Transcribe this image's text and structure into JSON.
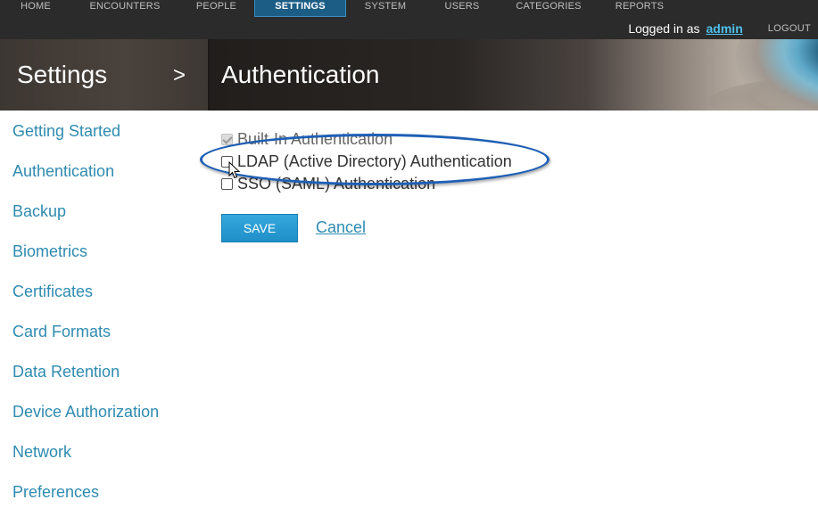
{
  "nav": {
    "items": [
      {
        "label": "HOME"
      },
      {
        "label": "ENCOUNTERS"
      },
      {
        "label": "PEOPLE"
      },
      {
        "label": "SETTINGS",
        "active": true
      },
      {
        "label": "SYSTEM"
      },
      {
        "label": "USERS"
      },
      {
        "label": "CATEGORIES"
      },
      {
        "label": "REPORTS"
      }
    ],
    "login_prefix": "Logged in as",
    "username": "admin",
    "logout_label": "LOGOUT"
  },
  "header": {
    "section_title": "Settings",
    "arrow": ">",
    "page_title": "Authentication"
  },
  "sidebar": {
    "items": [
      {
        "label": "Getting Started"
      },
      {
        "label": "Authentication"
      },
      {
        "label": "Backup"
      },
      {
        "label": "Biometrics"
      },
      {
        "label": "Certificates"
      },
      {
        "label": "Card Formats"
      },
      {
        "label": "Data Retention"
      },
      {
        "label": "Device Authorization"
      },
      {
        "label": "Network"
      },
      {
        "label": "Preferences"
      }
    ]
  },
  "main": {
    "options": [
      {
        "label": "Built-In Authentication",
        "checked": true,
        "disabled": true
      },
      {
        "label": "LDAP (Active Directory) Authentication",
        "checked": false,
        "disabled": false
      },
      {
        "label": "SSO (SAML) Authentication",
        "checked": false,
        "disabled": false
      }
    ],
    "save_label": "SAVE",
    "cancel_label": "Cancel"
  },
  "colors": {
    "accent": "#2e8bb0",
    "nav_active": "#1c5d86",
    "highlight_ellipse": "#1f5fb5",
    "save_button": "#2a9ad2"
  }
}
